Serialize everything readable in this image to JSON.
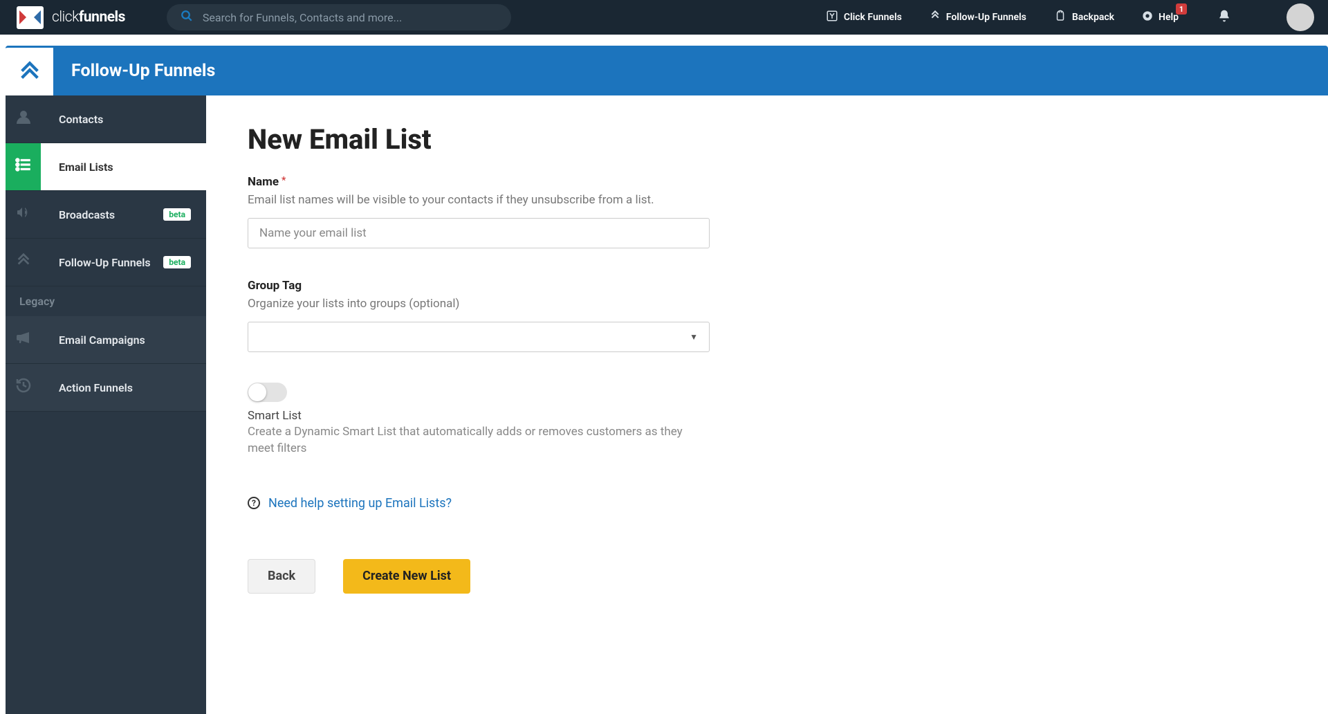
{
  "topbar": {
    "logoText": {
      "light": "click",
      "bold": "funnels"
    },
    "search": {
      "placeholder": "Search for Funnels, Contacts and more..."
    },
    "nav": {
      "clickFunnels": "Click Funnels",
      "followUpFunnels": "Follow-Up Funnels",
      "backpack": "Backpack",
      "help": "Help",
      "helpBadge": "1"
    }
  },
  "blueHeader": {
    "title": "Follow-Up Funnels"
  },
  "sidebar": {
    "items": {
      "contacts": "Contacts",
      "emailLists": "Email Lists",
      "broadcasts": "Broadcasts",
      "followUpFunnels": "Follow-Up Funnels",
      "emailCampaigns": "Email Campaigns",
      "actionFunnels": "Action Funnels"
    },
    "betaBadge": "beta",
    "legacyLabel": "Legacy"
  },
  "main": {
    "pageTitle": "New Email List",
    "nameField": {
      "label": "Name",
      "help": "Email list names will be visible to your contacts if they unsubscribe from a list.",
      "placeholder": "Name your email list"
    },
    "groupTagField": {
      "label": "Group Tag",
      "help": "Organize your lists into groups (optional)"
    },
    "smartList": {
      "label": "Smart List",
      "description": "Create a Dynamic Smart List that automatically adds or removes customers as they meet filters"
    },
    "helpLink": "Need help setting up Email Lists?",
    "buttons": {
      "back": "Back",
      "create": "Create New List"
    }
  }
}
